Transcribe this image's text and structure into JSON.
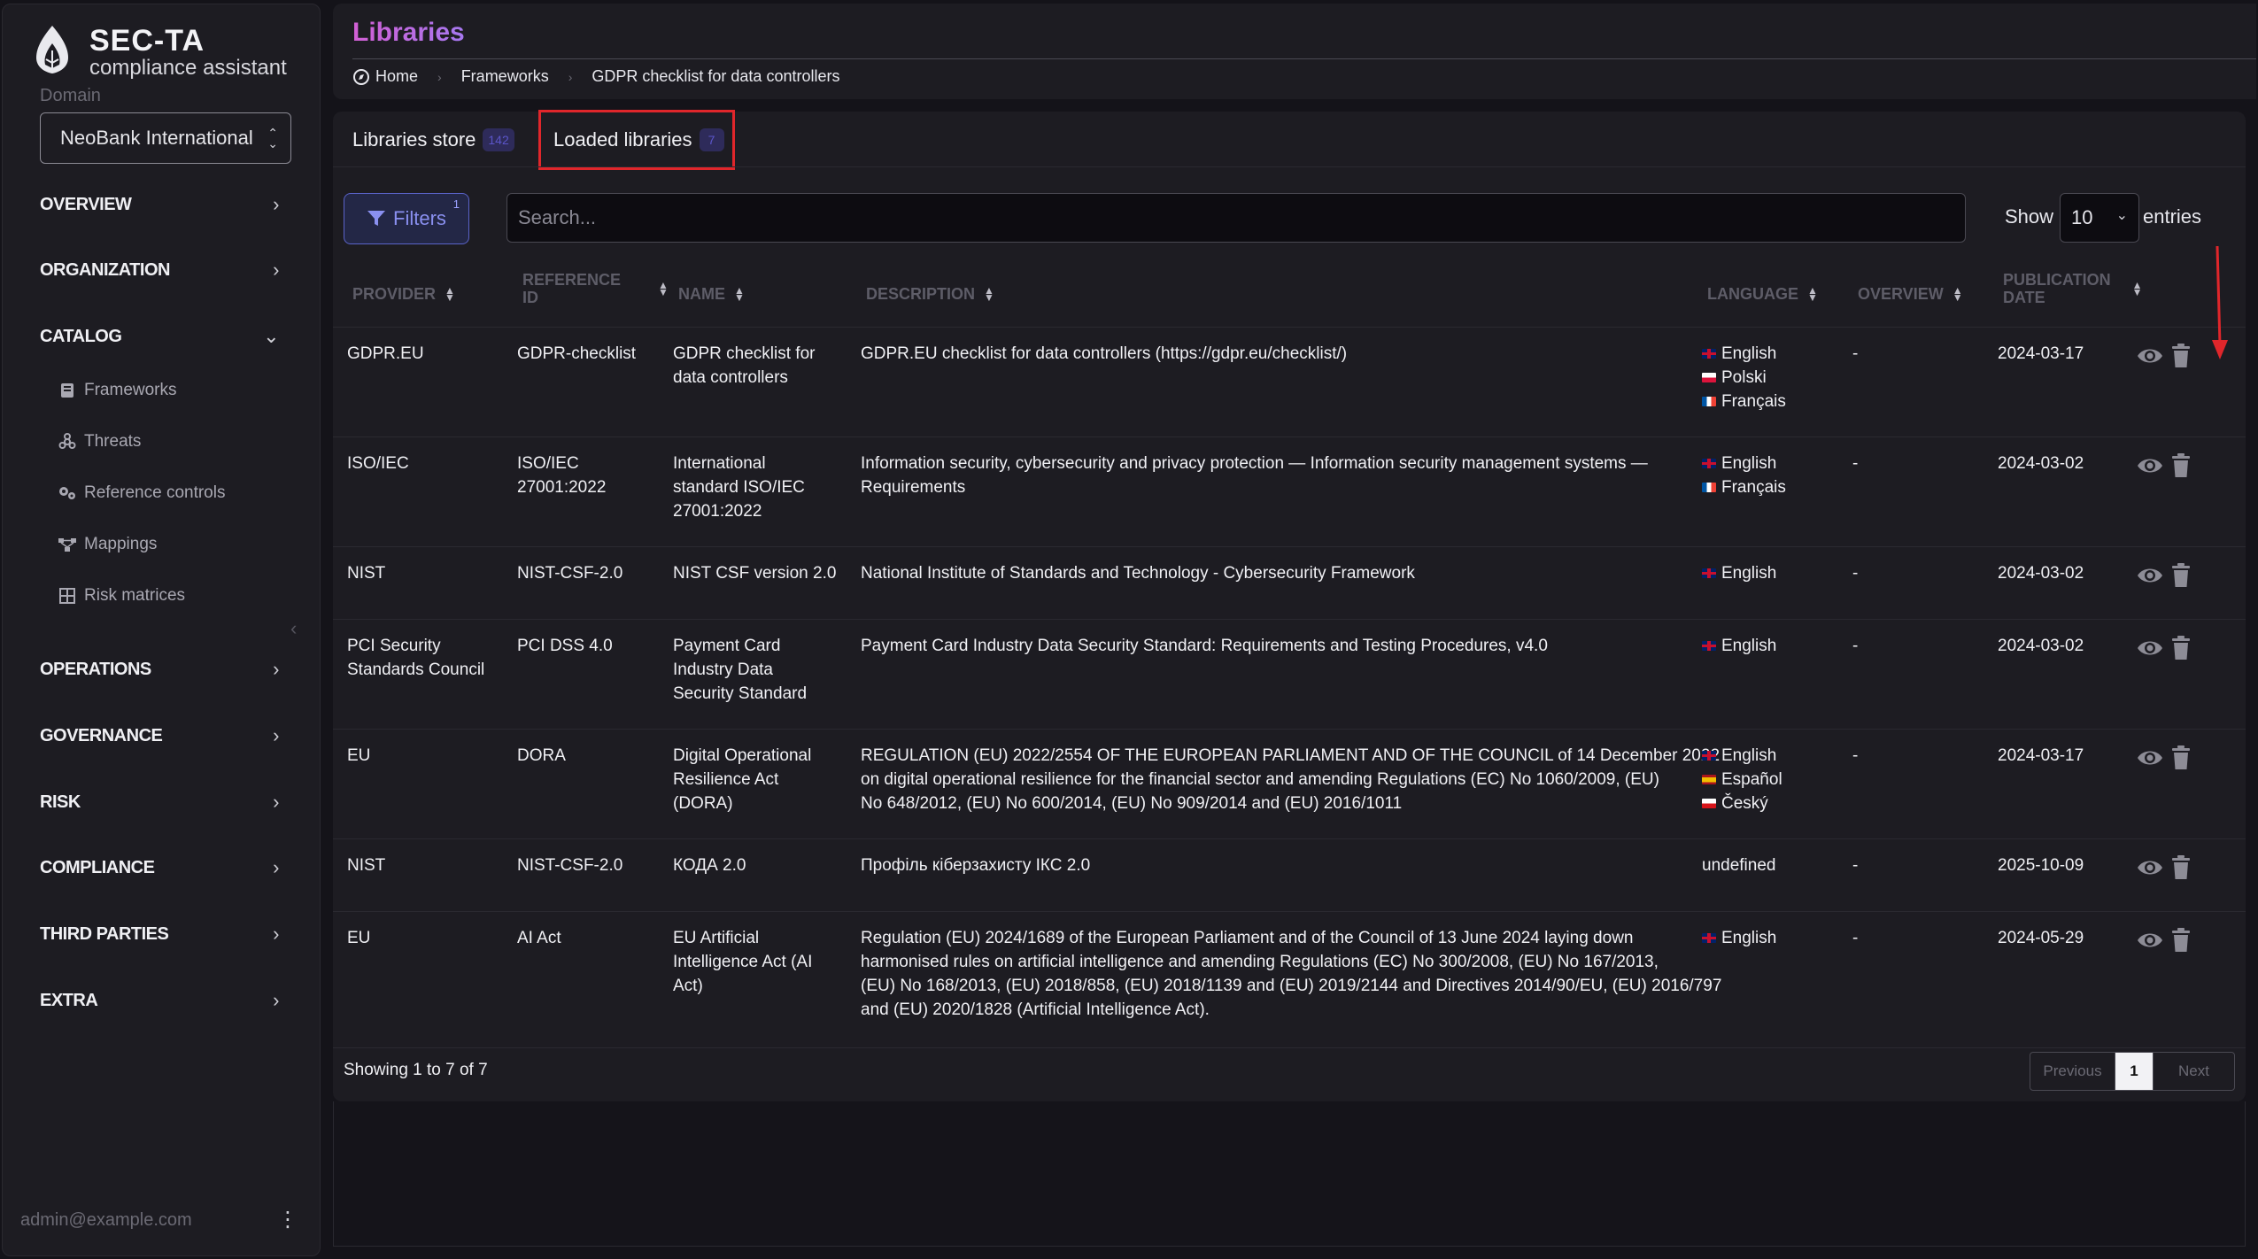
{
  "app": {
    "name": "SEC-TA",
    "tagline": "compliance assistant"
  },
  "sidebar": {
    "domain_label": "Domain",
    "domain_value": "NeoBank International",
    "sections": {
      "overview": "OVERVIEW",
      "organization": "ORGANIZATION",
      "catalog": "CATALOG",
      "operations": "OPERATIONS",
      "governance": "GOVERNANCE",
      "risk": "RISK",
      "compliance": "COMPLIANCE",
      "third_parties": "THIRD PARTIES",
      "extra": "EXTRA"
    },
    "catalog_items": {
      "frameworks": "Frameworks",
      "threats": "Threats",
      "reference_controls": "Reference controls",
      "mappings": "Mappings",
      "risk_matrices": "Risk matrices"
    },
    "user_email": "admin@example.com"
  },
  "header": {
    "title": "Libraries",
    "breadcrumb": {
      "home": "Home",
      "frameworks": "Frameworks",
      "current": "GDPR checklist for data controllers"
    }
  },
  "tabs": {
    "store": {
      "label": "Libraries store",
      "count": "142"
    },
    "loaded": {
      "label": "Loaded libraries",
      "count": "7"
    }
  },
  "toolbar": {
    "filters_label": "Filters",
    "filters_count": "1",
    "search_placeholder": "Search...",
    "show_label": "Show",
    "entries_value": "10",
    "entries_label": "entries"
  },
  "table": {
    "headers": {
      "provider": "PROVIDER",
      "ref_id_1": "REFERENCE",
      "ref_id_2": "ID",
      "name": "NAME",
      "description": "DESCRIPTION",
      "language": "LANGUAGE",
      "overview": "OVERVIEW",
      "pub_1": "PUBLICATION",
      "pub_2": "DATE"
    },
    "rows": [
      {
        "provider": [
          "GDPR.EU"
        ],
        "ref": [
          "GDPR-checklist"
        ],
        "name": [
          "GDPR checklist for",
          "data controllers"
        ],
        "description": [
          "GDPR.EU checklist for data controllers (https://gdpr.eu/checklist/)"
        ],
        "languages": [
          [
            "gb",
            "English"
          ],
          [
            "pl",
            "Polski"
          ],
          [
            "fr",
            "Français"
          ]
        ],
        "overview": "-",
        "date": "2024-03-17"
      },
      {
        "provider": [
          "ISO/IEC"
        ],
        "ref": [
          "ISO/IEC",
          "27001:2022"
        ],
        "name": [
          "International",
          "standard ISO/IEC",
          "27001:2022"
        ],
        "description": [
          "Information security, cybersecurity and privacy protection — Information security management systems —",
          "Requirements"
        ],
        "languages": [
          [
            "gb",
            "English"
          ],
          [
            "fr",
            "Français"
          ]
        ],
        "overview": "-",
        "date": "2024-03-02"
      },
      {
        "provider": [
          "NIST"
        ],
        "ref": [
          "NIST-CSF-2.0"
        ],
        "name": [
          "NIST CSF version 2.0"
        ],
        "description": [
          "National Institute of Standards and Technology - Cybersecurity Framework"
        ],
        "languages": [
          [
            "gb",
            "English"
          ]
        ],
        "overview": "-",
        "date": "2024-03-02"
      },
      {
        "provider": [
          "PCI Security",
          "Standards Council"
        ],
        "ref": [
          "PCI DSS 4.0"
        ],
        "name": [
          "Payment Card",
          "Industry Data",
          "Security Standard"
        ],
        "description": [
          "Payment Card Industry Data Security Standard: Requirements and Testing Procedures, v4.0"
        ],
        "languages": [
          [
            "gb",
            "English"
          ]
        ],
        "overview": "-",
        "date": "2024-03-02"
      },
      {
        "provider": [
          "EU"
        ],
        "ref": [
          "DORA"
        ],
        "name": [
          "Digital Operational",
          "Resilience Act",
          "(DORA)"
        ],
        "description": [
          "REGULATION (EU) 2022/2554 OF THE EUROPEAN PARLIAMENT AND OF THE COUNCIL of 14 December 2022",
          "on digital operational resilience for the financial sector and amending Regulations (EC) No 1060/2009, (EU)",
          "No 648/2012, (EU) No 600/2014, (EU) No 909/2014 and (EU) 2016/1011"
        ],
        "languages": [
          [
            "gb",
            "English"
          ],
          [
            "es",
            "Español"
          ],
          [
            "cz",
            "Český"
          ]
        ],
        "overview": "-",
        "date": "2024-03-17"
      },
      {
        "provider": [
          "NIST"
        ],
        "ref": [
          "NIST-CSF-2.0"
        ],
        "name": [
          "КОДА 2.0"
        ],
        "description": [
          "Профіль кіберзахисту ІКС 2.0"
        ],
        "languages": [
          [
            "",
            "undefined"
          ]
        ],
        "overview": "-",
        "date": "2025-10-09"
      },
      {
        "provider": [
          "EU"
        ],
        "ref": [
          "AI Act"
        ],
        "name": [
          "EU Artificial",
          "Intelligence Act (AI",
          "Act)"
        ],
        "description": [
          "Regulation (EU) 2024/1689 of the European Parliament and of the Council of 13 June 2024 laying down",
          "harmonised rules on artificial intelligence and amending Regulations (EC) No 300/2008, (EU) No 167/2013,",
          "(EU) No 168/2013, (EU) 2018/858, (EU) 2018/1139 and (EU) 2019/2144 and Directives 2014/90/EU, (EU) 2016/797",
          "and (EU) 2020/1828 (Artificial Intelligence Act)."
        ],
        "languages": [
          [
            "gb",
            "English"
          ]
        ],
        "overview": "-",
        "date": "2024-05-29"
      }
    ]
  },
  "footer": {
    "showing": "Showing 1 to 7 of 7",
    "previous": "Previous",
    "page": "1",
    "next": "Next"
  },
  "colors": {
    "accent": "#8a90f0",
    "highlight_box": "#e0262b",
    "title_gradient_start": "#d25fd4"
  },
  "icons": {
    "row_view": "eye-icon",
    "row_delete": "trash-icon",
    "filters": "funnel-icon",
    "home": "home-icon"
  }
}
